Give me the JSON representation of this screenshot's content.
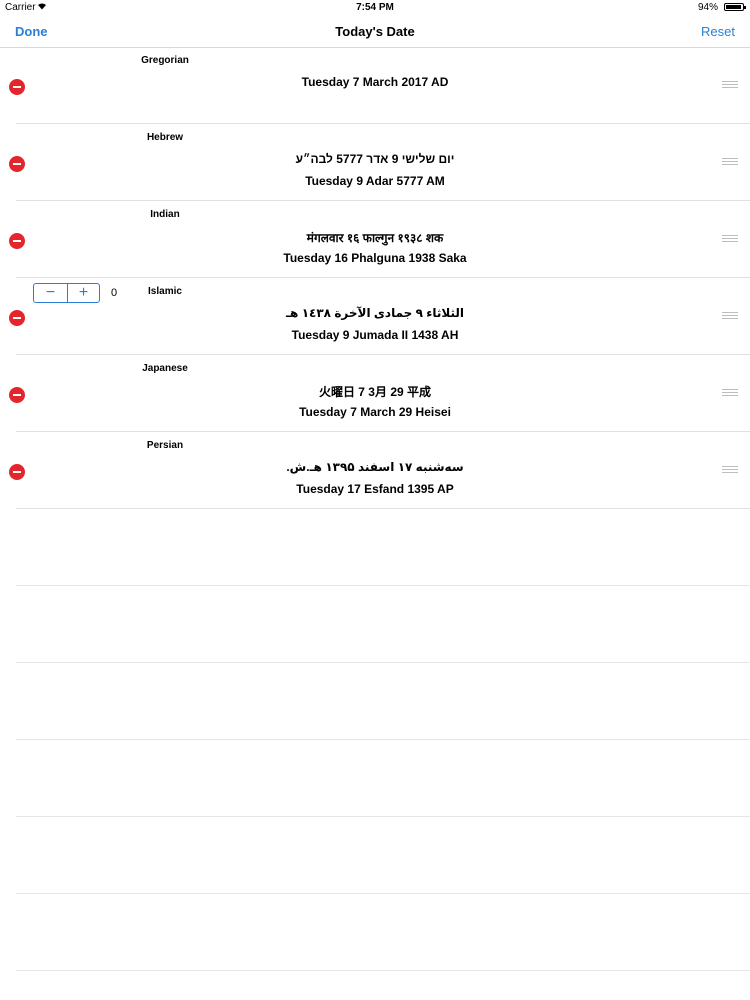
{
  "status_bar": {
    "carrier": "Carrier",
    "wifi_icon": "wifi-icon",
    "time": "7:54 PM",
    "battery_percent": "94%",
    "battery_level": 0.94
  },
  "nav": {
    "done_label": "Done",
    "title": "Today's Date",
    "reset_label": "Reset",
    "accent_color": "#2a7fd4"
  },
  "rows": [
    {
      "calendar": "Gregorian",
      "line1": "Tuesday 7 March 2017 AD",
      "line2": ""
    },
    {
      "calendar": "Hebrew",
      "line1": "יום שלישי 9 אדר 5777 לבה״ע",
      "line2": "Tuesday  9 Adar 5777 AM"
    },
    {
      "calendar": "Indian",
      "line1": "मंगलवार १६ फाल्गुन १९३८ शक",
      "line2": "Tuesday  16 Phalguna 1938 Saka"
    },
    {
      "calendar": "Islamic",
      "line1": "الثلاثاء ٩ جمادى الآخرة ١٤٣٨ هـ",
      "line2": "Tuesday  9 Jumada II 1438 AH"
    },
    {
      "calendar": "Japanese",
      "line1": "火曜日 7 3月 29 平成",
      "line2": "Tuesday  7 March 29 Heisei"
    },
    {
      "calendar": "Persian",
      "line1": "سه‌شنبه ۱۷ اسفند ۱۳۹۵ هـ.ش.",
      "line2": "Tuesday  17 Esfand 1395 AP"
    }
  ],
  "stepper": {
    "minus_label": "−",
    "plus_label": "+",
    "value": "0"
  },
  "delete_color": "#e4262c"
}
